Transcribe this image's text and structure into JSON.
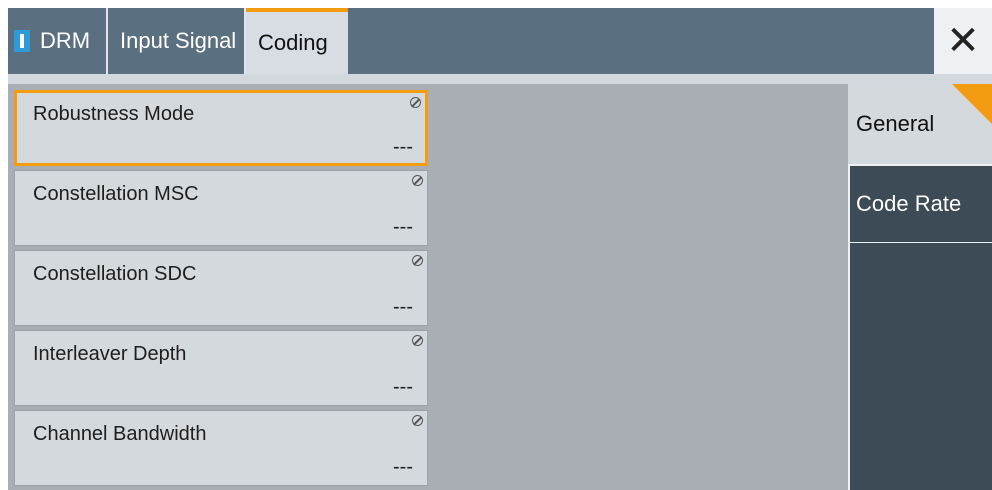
{
  "tabs": [
    {
      "label": "DRM",
      "icon": "drm-badge-icon"
    },
    {
      "label": "Input Signal"
    },
    {
      "label": "Coding",
      "active": true
    }
  ],
  "close_symbol": "✕",
  "fields": [
    {
      "label": "Robustness Mode",
      "value": "---",
      "selected": true
    },
    {
      "label": "Constellation MSC",
      "value": "---"
    },
    {
      "label": "Constellation SDC",
      "value": "---"
    },
    {
      "label": "Interleaver Depth",
      "value": "---"
    },
    {
      "label": "Channel Bandwidth",
      "value": "---"
    }
  ],
  "side_menu": [
    {
      "label": "General",
      "active": true
    },
    {
      "label": "Code Rate"
    }
  ],
  "colors": {
    "accent": "#f39c12",
    "tabbar": "#5a7080",
    "content_bg": "#a8aeb3",
    "field_bg": "#d4d9dd",
    "side_menu_bg": "#3c4b56",
    "drm_badge": "#2e9ad8"
  }
}
